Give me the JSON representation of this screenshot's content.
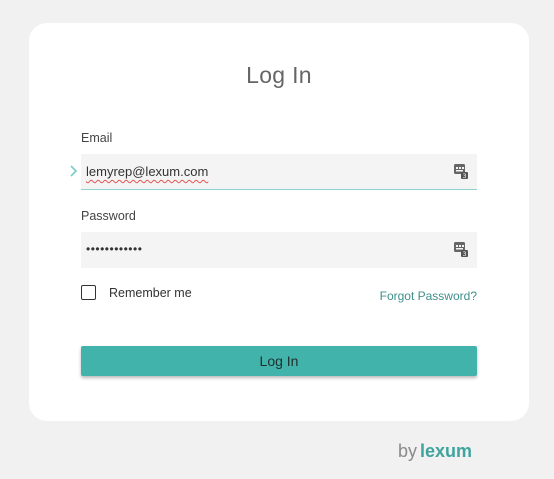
{
  "form": {
    "title": "Log In",
    "email_label": "Email",
    "email_value": "lemyrep@lexum.com",
    "password_label": "Password",
    "password_value": "••••••••••••",
    "remember_label": "Remember me",
    "remember_checked": false,
    "forgot_label": "Forgot Password?",
    "submit_label": "Log In"
  },
  "branding": {
    "by": "by",
    "name": "lexum"
  },
  "colors": {
    "accent": "#42b3ab",
    "link": "#3e8f8b",
    "background": "#f1f1f1",
    "card": "#ffffff"
  },
  "icons": {
    "field_icon": "password-manager-icon",
    "focus_indicator": "chevron-right-icon"
  }
}
